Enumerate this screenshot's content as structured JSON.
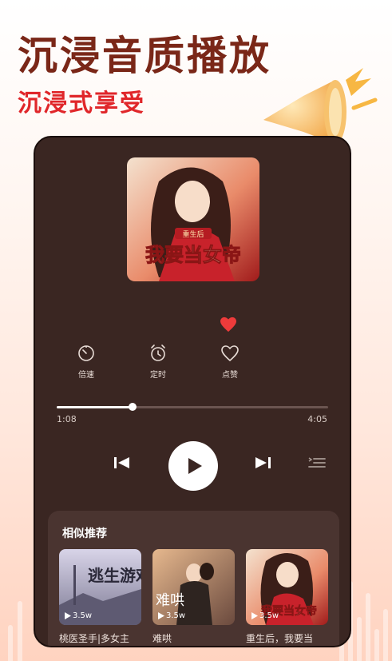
{
  "promo": {
    "headline": "沉浸音质播放",
    "subhead": "沉浸式享受"
  },
  "player": {
    "cover_art": {
      "badge": "重生后",
      "title": "我要当女帝"
    },
    "favorite_color": "#ee3b3b",
    "controls": [
      {
        "label": "倍速",
        "icon": "speed-icon"
      },
      {
        "label": "定时",
        "icon": "alarm-clock-icon"
      },
      {
        "label": "点赞",
        "icon": "heart-outline-icon"
      }
    ],
    "progress": {
      "current": "1:08",
      "total": "4:05",
      "fraction": 0.28
    }
  },
  "similar": {
    "title": "相似推荐",
    "items": [
      {
        "title": "桃医圣手|多女主",
        "count": "3.5w",
        "cover_text": "逃生游戏"
      },
      {
        "title": "难哄",
        "count": "3.5w",
        "cover_text": "难哄"
      },
      {
        "title": "重生后，我要当",
        "count": "3.5w",
        "cover_text": "我要当女帝"
      }
    ]
  }
}
